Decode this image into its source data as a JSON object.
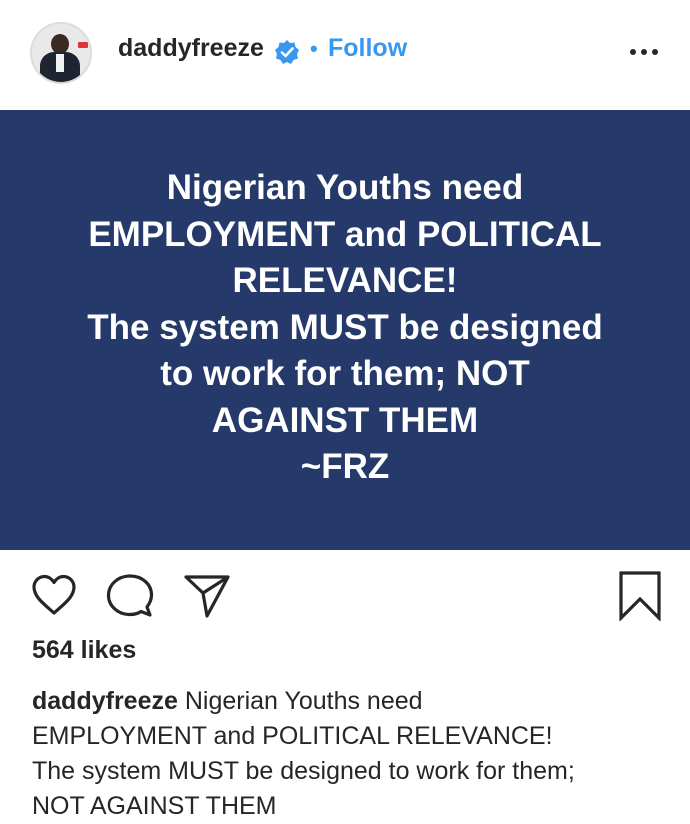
{
  "header": {
    "username": "daddyfreeze",
    "separator": "•",
    "follow_label": "Follow",
    "verified_color": "#3897f0",
    "icons": [
      "avatar",
      "verified-badge-icon",
      "more-options-icon"
    ]
  },
  "post": {
    "background_color": "#253a6a",
    "text": "Nigerian Youths need\nEMPLOYMENT and POLITICAL\nRELEVANCE!\nThe system MUST be designed\nto work for them; NOT\nAGAINST THEM\n~FRZ"
  },
  "actions": {
    "icons": [
      "heart-icon",
      "comment-icon",
      "share-icon",
      "bookmark-icon"
    ]
  },
  "likes": "564 likes",
  "caption": {
    "username": "daddyfreeze",
    "text": " Nigerian Youths need\nEMPLOYMENT and POLITICAL RELEVANCE!\nThe system MUST be designed to work for them;\nNOT AGAINST THEM"
  }
}
